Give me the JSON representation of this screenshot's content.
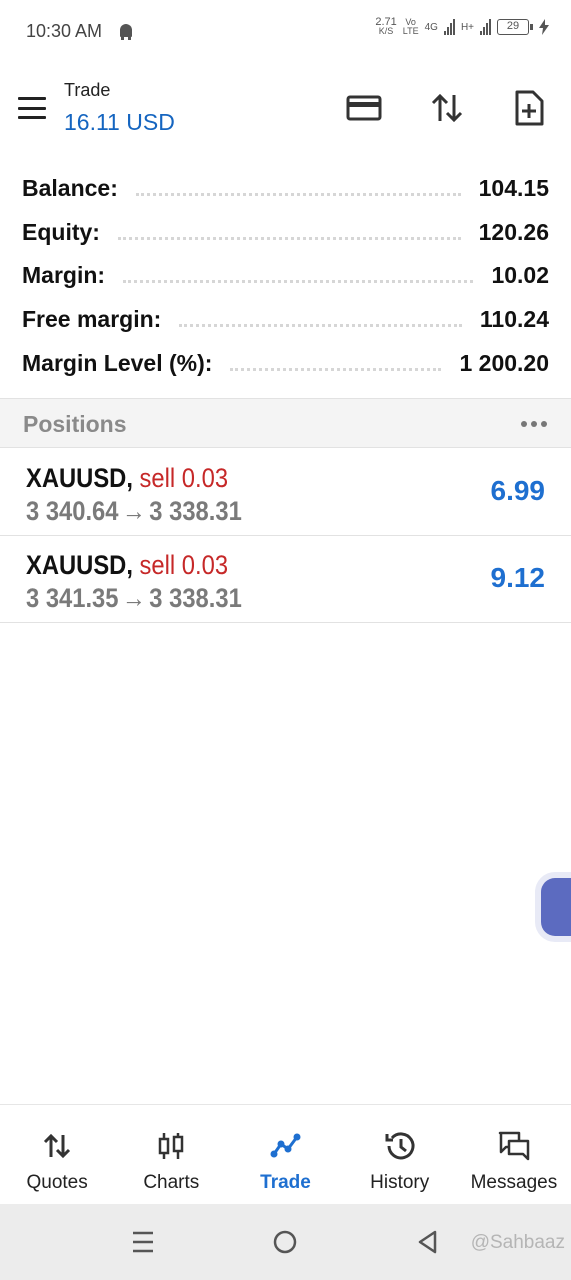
{
  "status_bar": {
    "time": "10:30 AM",
    "net_speed": "2.71",
    "net_speed_unit": "K/S",
    "volte": "Vo",
    "lte": "LTE",
    "network_4g": "4G",
    "network_h": "H+",
    "battery": "29"
  },
  "header": {
    "title": "Trade",
    "subtitle": "16.11 USD"
  },
  "summary": [
    {
      "label": "Balance:",
      "value": "104.15"
    },
    {
      "label": "Equity:",
      "value": "120.26"
    },
    {
      "label": "Margin:",
      "value": "10.02"
    },
    {
      "label": "Free margin:",
      "value": "110.24"
    },
    {
      "label": "Margin Level (%):",
      "value": "1 200.20"
    }
  ],
  "positions": {
    "title": "Positions",
    "items": [
      {
        "symbol": "XAUUSD,",
        "type": "sell 0.03",
        "open_price": "3 340.64",
        "arrow": "→",
        "current_price": "3 338.31",
        "profit": "6.99"
      },
      {
        "symbol": "XAUUSD,",
        "type": "sell 0.03",
        "open_price": "3 341.35",
        "arrow": "→",
        "current_price": "3 338.31",
        "profit": "9.12"
      }
    ]
  },
  "bottom_nav": [
    {
      "label": "Quotes",
      "icon": "quotes-icon"
    },
    {
      "label": "Charts",
      "icon": "charts-icon"
    },
    {
      "label": "Trade",
      "icon": "trade-icon",
      "active": true
    },
    {
      "label": "History",
      "icon": "history-icon"
    },
    {
      "label": "Messages",
      "icon": "messages-icon"
    }
  ],
  "watermark": "@Sahbaaz",
  "colors": {
    "accent": "#1e6fd0",
    "sell": "#c62828",
    "header_sub": "#1565c0"
  }
}
